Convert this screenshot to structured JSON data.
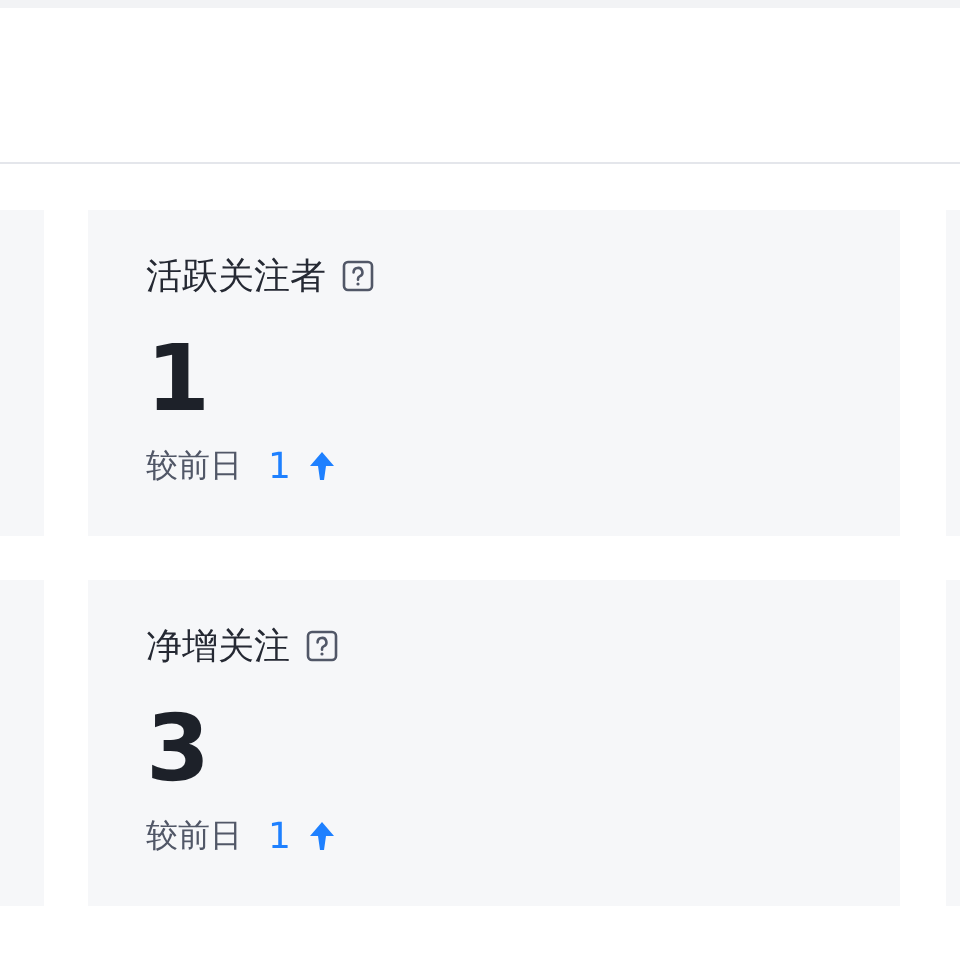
{
  "cards": [
    {
      "title": "活跃关注者",
      "value": "1",
      "compare_label": "较前日",
      "change": "1",
      "rising": true
    },
    {
      "title": "净增关注",
      "value": "3",
      "compare_label": "较前日",
      "change": "1",
      "rising": true
    }
  ]
}
